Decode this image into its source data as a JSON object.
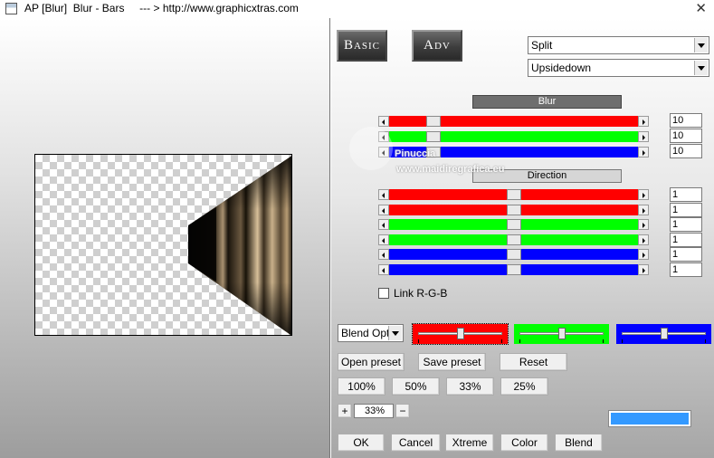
{
  "window": {
    "title": "AP [Blur]  Blur - Bars     --- > http://www.graphicxtras.com",
    "close_glyph": "✕"
  },
  "tabs": {
    "basic": "Basic",
    "adv": "Adv"
  },
  "dropdowns": {
    "mode": "Split",
    "direction": "Upsidedown"
  },
  "blur": {
    "label": "Blur",
    "rows": [
      {
        "color": "#ff0000",
        "value": "10",
        "level": 0.16
      },
      {
        "color": "#00ff00",
        "value": "10",
        "level": 0.16
      },
      {
        "color": "#0000ff",
        "value": "10",
        "level": 0.16
      }
    ]
  },
  "direction": {
    "label": "Direction",
    "rows": [
      {
        "color": "#ff0000",
        "value": "1",
        "level": 0.5
      },
      {
        "color": "#ff0000",
        "value": "1",
        "level": 0.5
      },
      {
        "color": "#00ff00",
        "value": "1",
        "level": 0.5
      },
      {
        "color": "#00ff00",
        "value": "1",
        "level": 0.5
      },
      {
        "color": "#0000ff",
        "value": "1",
        "level": 0.5
      },
      {
        "color": "#0000ff",
        "value": "1",
        "level": 0.5
      }
    ]
  },
  "link_rgb": {
    "label": "Link R-G-B",
    "checked": false
  },
  "blend": {
    "select_value": "Blend Optic",
    "channels": [
      {
        "color": "#ff0000",
        "level": 0.5
      },
      {
        "color": "#00ff00",
        "level": 0.5
      },
      {
        "color": "#0000ff",
        "level": 0.5
      }
    ]
  },
  "buttons": {
    "open_preset": "Open preset",
    "save_preset": "Save preset",
    "reset": "Reset",
    "zoom_100": "100%",
    "zoom_50": "50%",
    "zoom_33": "33%",
    "zoom_25": "25%",
    "plus": "+",
    "minus": "−",
    "ok": "OK",
    "cancel": "Cancel",
    "xtreme": "Xtreme",
    "color": "Color",
    "blend": "Blend"
  },
  "zoom_value": "33%",
  "swatch_color": "#3399ff",
  "watermark": {
    "line1": "Pinuccia",
    "line2": "www.maidiregrafica.eu"
  }
}
